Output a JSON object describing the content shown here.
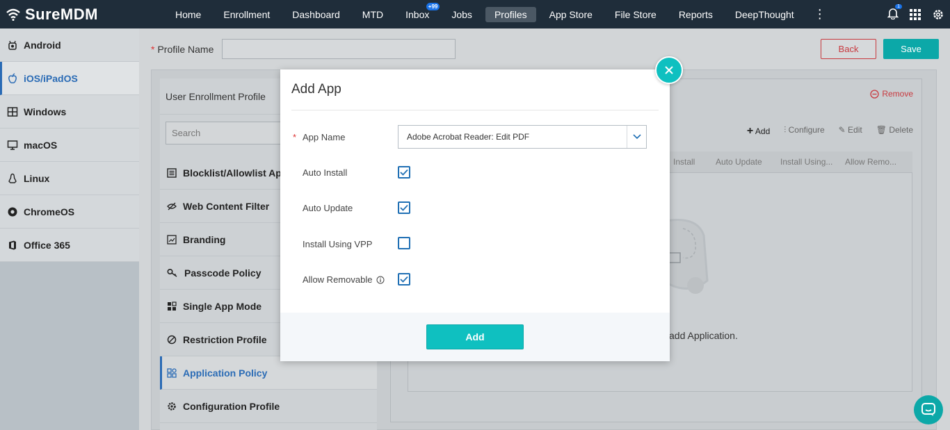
{
  "app": {
    "name": "SureMDM"
  },
  "nav": {
    "items": [
      "Home",
      "Enrollment",
      "Dashboard",
      "MTD",
      "Inbox",
      "Jobs",
      "Profiles",
      "App Store",
      "File Store",
      "Reports",
      "DeepThought"
    ],
    "inbox_badge": "+99",
    "active": "Profiles",
    "notification_count": "1"
  },
  "sidebar": {
    "items": [
      {
        "label": "Android",
        "icon": "android-icon"
      },
      {
        "label": "iOS/iPadOS",
        "icon": "apple-icon"
      },
      {
        "label": "Windows",
        "icon": "windows-icon"
      },
      {
        "label": "macOS",
        "icon": "monitor-icon"
      },
      {
        "label": "Linux",
        "icon": "linux-icon"
      },
      {
        "label": "ChromeOS",
        "icon": "chrome-icon"
      },
      {
        "label": "Office 365",
        "icon": "office-icon"
      }
    ],
    "active": "iOS/iPadOS"
  },
  "profile": {
    "label": "Profile Name",
    "value": ""
  },
  "buttons": {
    "back": "Back",
    "save": "Save"
  },
  "left_panel": {
    "header": "User Enrollment Profile",
    "search_placeholder": "Search",
    "policies": [
      {
        "label": "Blocklist/Allowlist Ap",
        "icon": "list-icon"
      },
      {
        "label": "Web Content Filter",
        "icon": "eye-off-icon"
      },
      {
        "label": "Branding",
        "icon": "image-icon"
      },
      {
        "label": "Passcode Policy",
        "icon": "key-icon"
      },
      {
        "label": "Single App Mode",
        "icon": "grid-icon"
      },
      {
        "label": "Restriction Profile",
        "icon": "ban-icon"
      },
      {
        "label": "Application Policy",
        "icon": "apps-icon"
      },
      {
        "label": "Configuration Profile",
        "icon": "gear-icon"
      }
    ],
    "active": "Application Policy"
  },
  "right_panel": {
    "remove": "Remove",
    "actions": [
      "Add",
      "Configure",
      "Edit",
      "Delete"
    ],
    "columns": [
      "Install",
      "Auto Update",
      "Install Using...",
      "Allow Remo..."
    ],
    "empty_text": "add Application."
  },
  "modal": {
    "title": "Add App",
    "app_name_label": "App Name",
    "app_name_value": "Adobe Acrobat Reader: Edit PDF",
    "options": [
      {
        "label": "Auto Install",
        "checked": true
      },
      {
        "label": "Auto Update",
        "checked": true
      },
      {
        "label": "Install Using VPP",
        "checked": false
      },
      {
        "label": "Allow Removable",
        "checked": true
      }
    ],
    "add_button": "Add"
  }
}
